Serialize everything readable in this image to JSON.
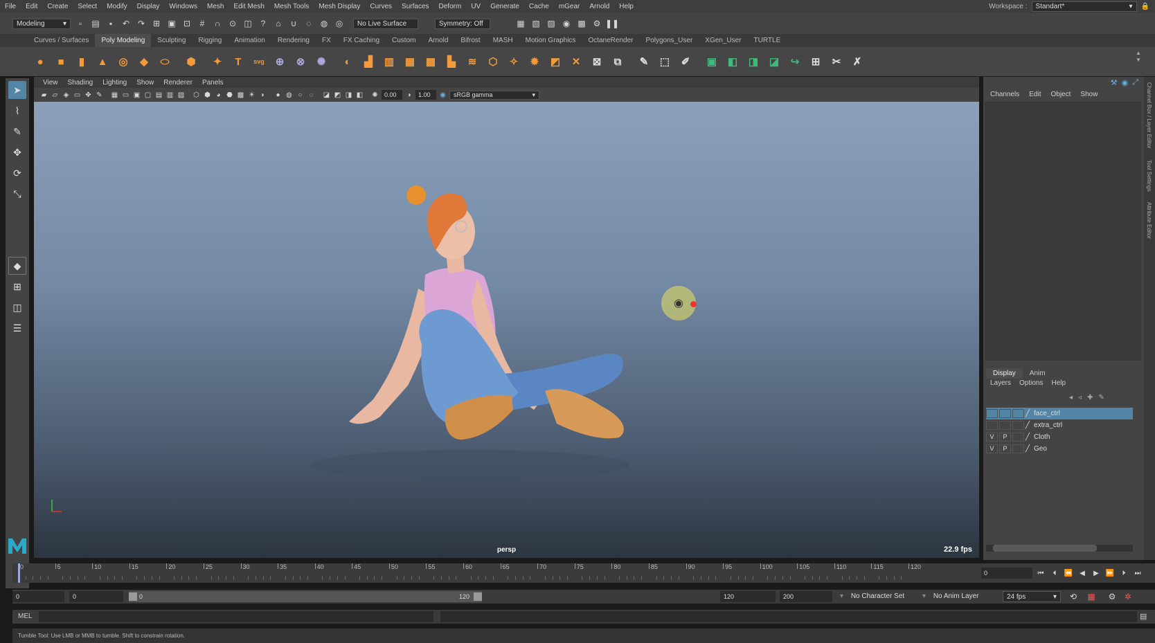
{
  "menus": [
    "File",
    "Edit",
    "Create",
    "Select",
    "Modify",
    "Display",
    "Windows",
    "Mesh",
    "Edit Mesh",
    "Mesh Tools",
    "Mesh Display",
    "Curves",
    "Surfaces",
    "Deform",
    "UV",
    "Generate",
    "Cache",
    "mGear",
    "Arnold",
    "Help"
  ],
  "workspace": {
    "label": "Workspace :",
    "value": "Standart*"
  },
  "statusline": {
    "mode": "Modeling",
    "live_surface": "No Live Surface",
    "symmetry": "Symmetry: Off"
  },
  "shelf_tabs": [
    "Curves / Surfaces",
    "Poly Modeling",
    "Sculpting",
    "Rigging",
    "Animation",
    "Rendering",
    "FX",
    "FX Caching",
    "Custom",
    "Arnold",
    "Bifrost",
    "MASH",
    "Motion Graphics",
    "OctaneRender",
    "Polygons_User",
    "XGen_User",
    "TURTLE"
  ],
  "shelf_active": "Poly Modeling",
  "panel_menu": [
    "View",
    "Shading",
    "Lighting",
    "Show",
    "Renderer",
    "Panels"
  ],
  "panel_toolbar": {
    "exposure": "0.00",
    "gamma": "1.00",
    "color_space": "sRGB gamma"
  },
  "viewport": {
    "camera": "persp",
    "fps": "22.9 fps"
  },
  "channel_box": {
    "menu": [
      "Channels",
      "Edit",
      "Object",
      "Show"
    ]
  },
  "layer_editor": {
    "tabs": [
      "Display",
      "Anim"
    ],
    "menu": [
      "Layers",
      "Options",
      "Help"
    ],
    "layers": [
      {
        "v": "",
        "p": "",
        "name": "face_ctrl",
        "selected": true
      },
      {
        "v": "",
        "p": "",
        "name": "extra_ctrl",
        "selected": false
      },
      {
        "v": "V",
        "p": "P",
        "name": "Cloth",
        "selected": false
      },
      {
        "v": "V",
        "p": "P",
        "name": "Geo",
        "selected": false
      }
    ]
  },
  "side_tabs": [
    "Channel Box / Layer Editor",
    "Tool Settings",
    "Attribute Editor"
  ],
  "timeline": {
    "ticks": [
      "0",
      "5",
      "10",
      "15",
      "20",
      "25",
      "30",
      "35",
      "40",
      "45",
      "50",
      "55",
      "60",
      "65",
      "70",
      "75",
      "80",
      "85",
      "90",
      "95",
      "100",
      "105",
      "110",
      "115",
      "120"
    ],
    "current_frame": "0"
  },
  "range": {
    "start": "0",
    "inner_start": "0",
    "slider_start": "0",
    "slider_end": "120",
    "end": "120",
    "max": "200",
    "character_set": "No Character Set",
    "anim_layer": "No Anim Layer",
    "fps": "24 fps"
  },
  "mel": {
    "label": "MEL"
  },
  "help_line": "Tumble Tool: Use LMB or MMB to tumble. Shift to constrain rotation.",
  "colors": {
    "selection": "#5285a6",
    "viewport_top": "#8aa0bb",
    "viewport_bottom": "#2c3540",
    "maya_logo": "#2aa9c9"
  }
}
